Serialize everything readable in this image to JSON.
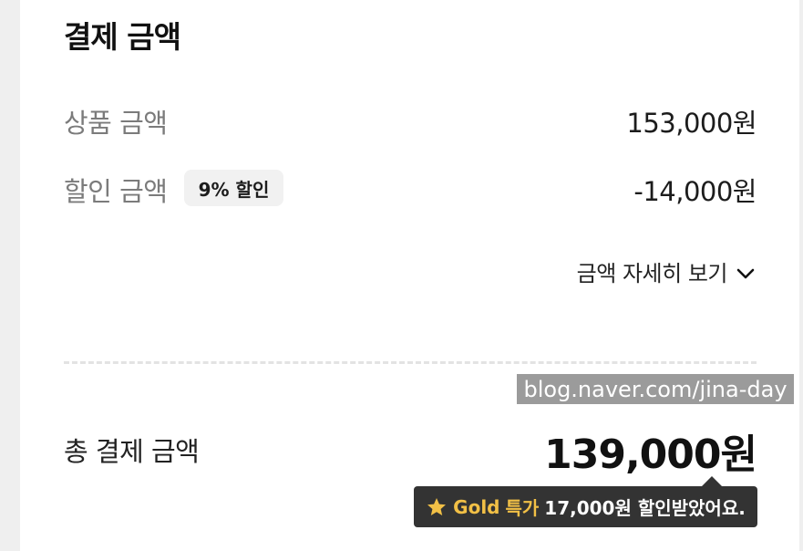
{
  "payment": {
    "title": "결제 금액",
    "product": {
      "label": "상품 금액",
      "value": "153,000원"
    },
    "discount": {
      "label": "할인 금액",
      "badge": "9% 할인",
      "value": "-14,000원"
    },
    "details_link": "금액 자세히 보기",
    "watermark": "blog.naver.com/jina-day",
    "total": {
      "label": "총 결제 금액",
      "value": "139,000원"
    },
    "tooltip": {
      "gold": "Gold",
      "special": "특가",
      "message": "17,000원 할인받았어요."
    }
  },
  "colors": {
    "gold": "#f2c046",
    "tooltip_bg": "#333333",
    "muted_text": "#7b7b7b"
  },
  "icons": {
    "details": "chevron-down-icon",
    "tier": "star-icon"
  }
}
